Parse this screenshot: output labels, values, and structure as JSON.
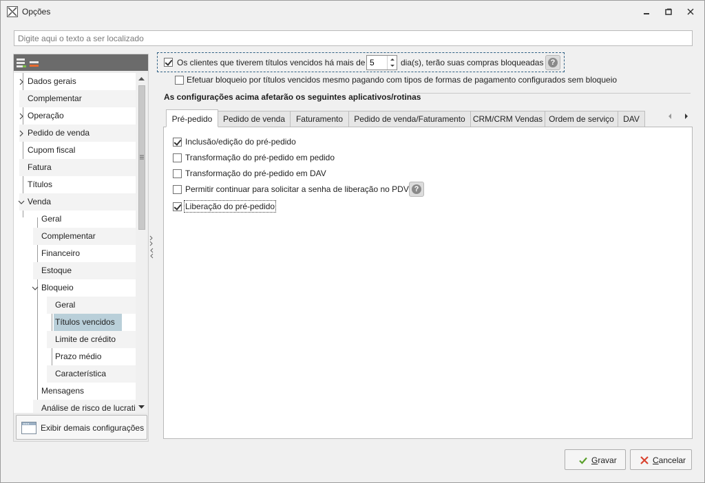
{
  "window": {
    "title": "Opções"
  },
  "search": {
    "placeholder": "Digite aqui o texto a ser localizado"
  },
  "tree": {
    "items": [
      {
        "label": "Dados gerais",
        "level": 0,
        "expander": "collapsed"
      },
      {
        "label": "Complementar",
        "level": 0,
        "expander": "none"
      },
      {
        "label": "Operação",
        "level": 0,
        "expander": "collapsed"
      },
      {
        "label": "Pedido de venda",
        "level": 0,
        "expander": "collapsed"
      },
      {
        "label": "Cupom fiscal",
        "level": 0,
        "expander": "none"
      },
      {
        "label": "Fatura",
        "level": 0,
        "expander": "none"
      },
      {
        "label": "Títulos",
        "level": 0,
        "expander": "none"
      },
      {
        "label": "Venda",
        "level": 0,
        "expander": "expanded"
      },
      {
        "label": "Geral",
        "level": 1,
        "expander": "none"
      },
      {
        "label": "Complementar",
        "level": 1,
        "expander": "none"
      },
      {
        "label": "Financeiro",
        "level": 1,
        "expander": "none"
      },
      {
        "label": "Estoque",
        "level": 1,
        "expander": "none"
      },
      {
        "label": "Bloqueio",
        "level": 1,
        "expander": "expanded"
      },
      {
        "label": "Geral",
        "level": 2,
        "expander": "none"
      },
      {
        "label": "Títulos vencidos",
        "level": 2,
        "expander": "none",
        "selected": true
      },
      {
        "label": "Limite de crédito",
        "level": 2,
        "expander": "none"
      },
      {
        "label": "Prazo médio",
        "level": 2,
        "expander": "none"
      },
      {
        "label": "Característica",
        "level": 2,
        "expander": "none"
      },
      {
        "label": "Mensagens",
        "level": 1,
        "expander": "none"
      },
      {
        "label": "Análise de risco de lucrati",
        "level": 1,
        "expander": "none"
      }
    ],
    "more_button_label": "Exibir demais configurações"
  },
  "block_rule": {
    "checked": true,
    "label_before": "Os clientes que tiverem títulos vencidos há mais de",
    "days_value": "5",
    "label_after": "dia(s), terão suas compras bloqueadas"
  },
  "block_even_paying": {
    "checked": false,
    "label": "Efetuar bloqueio por títulos vencidos mesmo pagando com tipos de formas de pagamento configurados sem bloqueio"
  },
  "section": {
    "title": "As configurações acima afetarão os seguintes aplicativos/rotinas"
  },
  "tabs": [
    {
      "label": "Pré-pedido",
      "active": true
    },
    {
      "label": "Pedido de venda"
    },
    {
      "label": "Faturamento"
    },
    {
      "label": "Pedido de venda/Faturamento"
    },
    {
      "label": "CRM/CRM Vendas"
    },
    {
      "label": "Ordem de serviço"
    },
    {
      "label": "DAV"
    }
  ],
  "options": [
    {
      "label": "Inclusão/edição do pré-pedido",
      "checked": true
    },
    {
      "label": "Transformação do pré-pedido em pedido",
      "checked": false
    },
    {
      "label": "Transformação do pré-pedido em DAV",
      "checked": false
    },
    {
      "label": "Permitir continuar para solicitar a senha de liberação no PDV",
      "checked": false,
      "help": true
    },
    {
      "label": "Liberação do pré-pedido",
      "checked": true,
      "focused": true
    }
  ],
  "buttons": {
    "save": {
      "label": "Gravar",
      "accel": "G"
    },
    "cancel": {
      "label": "Cancelar",
      "accel": "C"
    }
  },
  "help_glyph": "?",
  "colors": {
    "accent_check": "#5aa02c",
    "cancel_x": "#d9432f",
    "selection": "#b9cfd9",
    "focus_border": "#2e5f83"
  }
}
